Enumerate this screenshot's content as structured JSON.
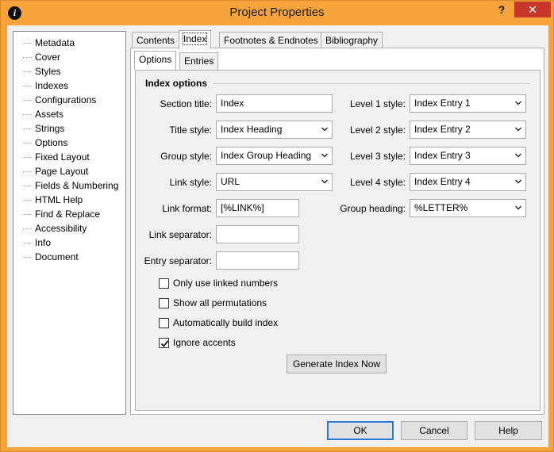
{
  "window": {
    "title": "Project Properties",
    "help_glyph": "?",
    "close_glyph": "✕",
    "app_icon_glyph": "i"
  },
  "sidebar": {
    "items": [
      {
        "label": "Metadata"
      },
      {
        "label": "Cover"
      },
      {
        "label": "Styles"
      },
      {
        "label": "Indexes"
      },
      {
        "label": "Configurations"
      },
      {
        "label": "Assets"
      },
      {
        "label": "Strings"
      },
      {
        "label": "Options"
      },
      {
        "label": "Fixed Layout"
      },
      {
        "label": "Page Layout"
      },
      {
        "label": "Fields & Numbering"
      },
      {
        "label": "HTML Help"
      },
      {
        "label": "Find & Replace"
      },
      {
        "label": "Accessibility"
      },
      {
        "label": "Info"
      },
      {
        "label": "Document"
      }
    ]
  },
  "tabs": {
    "contents": "Contents",
    "index": "Index",
    "footnotes": "Footnotes & Endnotes",
    "bibliography": "Bibliography"
  },
  "subtabs": {
    "options": "Options",
    "entries": "Entries"
  },
  "index_options": {
    "group_title": "Index options",
    "section_title": {
      "label": "Section title:",
      "value": "Index"
    },
    "title_style": {
      "label": "Title style:",
      "value": "Index Heading"
    },
    "group_style": {
      "label": "Group style:",
      "value": "Index Group Heading"
    },
    "link_style": {
      "label": "Link style:",
      "value": "URL"
    },
    "link_format": {
      "label": "Link format:",
      "value": "[%LINK%]"
    },
    "link_separator": {
      "label": "Link separator:",
      "value": ""
    },
    "entry_separator": {
      "label": "Entry separator:",
      "value": ""
    },
    "level1_style": {
      "label": "Level 1 style:",
      "value": "Index Entry 1"
    },
    "level2_style": {
      "label": "Level 2 style:",
      "value": "Index Entry 2"
    },
    "level3_style": {
      "label": "Level 3 style:",
      "value": "Index Entry 3"
    },
    "level4_style": {
      "label": "Level 4 style:",
      "value": "Index Entry 4"
    },
    "group_heading": {
      "label": "Group heading:",
      "value": "%LETTER%"
    },
    "checkboxes": {
      "only_linked": {
        "label": "Only use linked numbers",
        "checked": false
      },
      "show_permutations": {
        "label": "Show all permutations",
        "checked": false
      },
      "auto_build": {
        "label": "Automatically build index",
        "checked": false
      },
      "ignore_accents": {
        "label": "Ignore accents",
        "checked": true
      }
    },
    "generate_button": "Generate Index Now"
  },
  "footer": {
    "ok": "OK",
    "cancel": "Cancel",
    "help": "Help"
  },
  "colors": {
    "titlebar": "#f5a33a",
    "close_button": "#c7382b",
    "default_button_border": "#2a78d4"
  }
}
